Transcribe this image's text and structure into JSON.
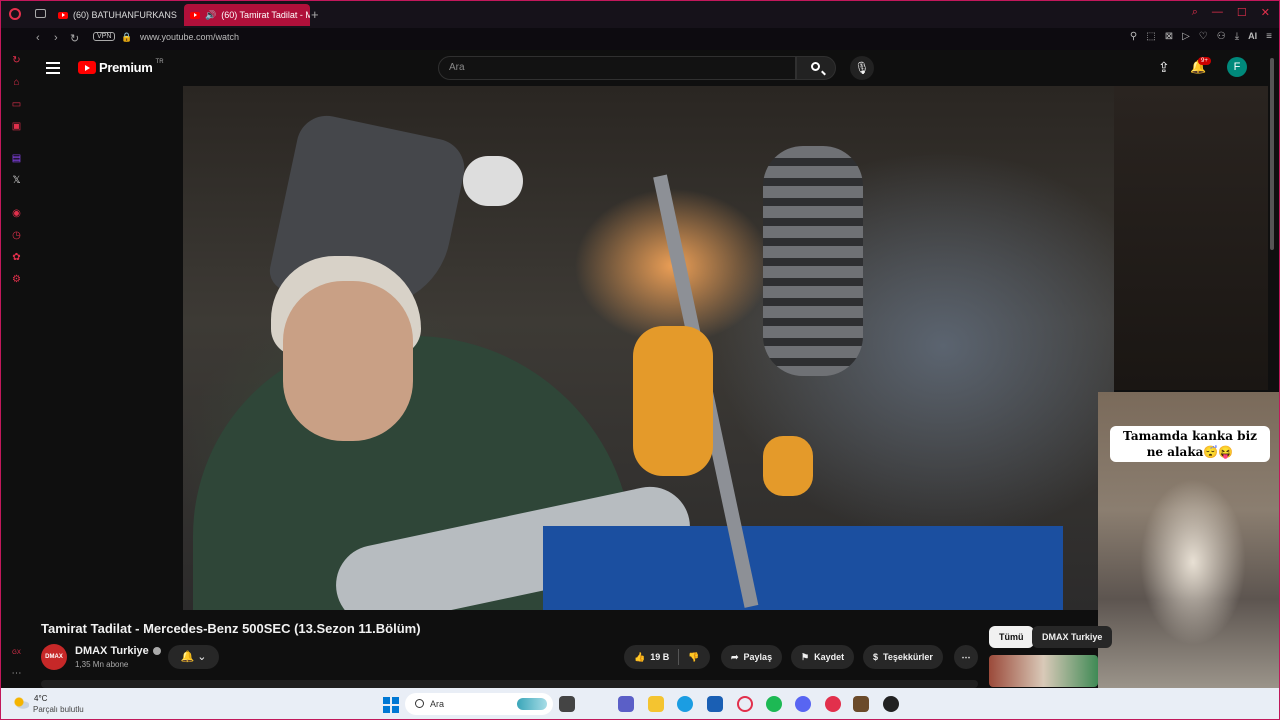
{
  "browser": {
    "tabs": [
      {
        "label": "(60) BATUHANFURKANS"
      },
      {
        "label": "(60) Tamirat Tadilat - M"
      }
    ],
    "vpn_label": "VPN",
    "url": "www.youtube.com/watch",
    "ai_label": "AI",
    "accent": "#e2304c"
  },
  "youtube": {
    "logo_text": "Premium",
    "logo_region": "TR",
    "search_placeholder": "Ara",
    "notif_badge": "9+",
    "avatar_letter": "F",
    "brand_red": "#ff0000"
  },
  "video": {
    "title": "Tamirat Tadilat - Mercedes-Benz 500SEC (13.Sezon 11.Bölüm)",
    "channel": {
      "avatar_text": "DMAX",
      "name": "DMAX Turkiye",
      "subscribers": "1,35 Mn abone"
    },
    "actions": {
      "likes": "19 B",
      "share": "Paylaş",
      "save": "Kaydet",
      "thanks": "Teşekkürler"
    }
  },
  "recommend_chips": [
    "Tümü",
    "DMAX Turkiye"
  ],
  "miniplayer": {
    "caption": "Tamamda kanka biz ne alaka😴😝"
  },
  "taskbar": {
    "temperature": "4°C",
    "weather": "Parçalı bulutlu",
    "search_label": "Ara"
  }
}
